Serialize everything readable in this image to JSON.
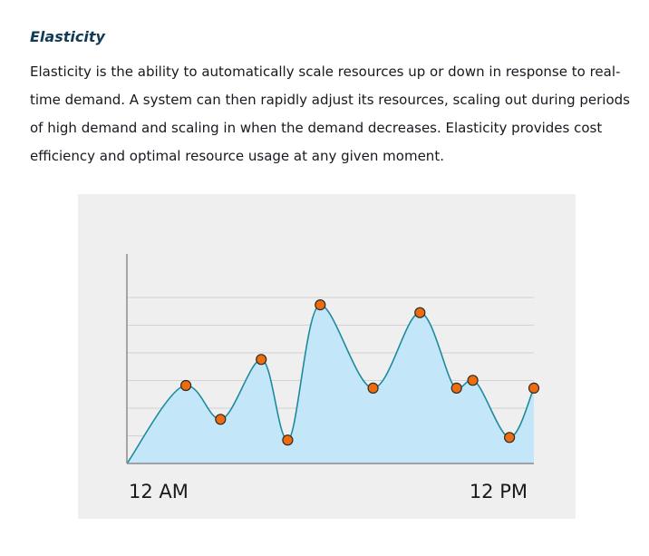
{
  "section": {
    "title": "Elasticity",
    "body": "Elasticity is the ability to automatically scale resources up or down in response to real-time demand. A system can then rapidly adjust its resources, scaling out during periods of high demand and scaling in when the demand decreases. Elasticity provides cost efficiency and optimal resource usage at any given moment."
  },
  "chart_data": {
    "type": "area",
    "x_tick_labels": [
      "12 AM",
      "12 PM"
    ],
    "x": [
      0,
      1.45,
      2.3,
      3.3,
      3.95,
      4.75,
      6.05,
      7.2,
      8.1,
      8.5,
      9.4,
      10.0
    ],
    "values": [
      0,
      3.0,
      1.7,
      4.0,
      0.9,
      6.1,
      2.9,
      5.8,
      2.9,
      3.2,
      1.0,
      2.9
    ],
    "markers": [
      false,
      true,
      true,
      true,
      true,
      true,
      true,
      true,
      true,
      true,
      true,
      true
    ],
    "xlim": [
      0,
      10
    ],
    "ylim": [
      0,
      7.5
    ],
    "grid": true,
    "colors": {
      "line": "#1f8a9c",
      "fill": "#c3e6f9",
      "marker_fill": "#ef6c0e",
      "marker_stroke": "#2b2b2b",
      "grid": "#d2d2d2",
      "axis": "#8c8c8c"
    }
  }
}
